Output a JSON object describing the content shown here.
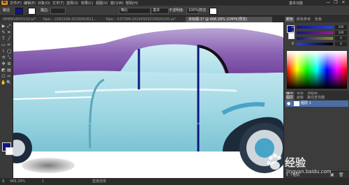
{
  "app": {
    "logo": "Ai"
  },
  "menu": [
    "文件(F)",
    "编辑(E)",
    "对象(O)",
    "文字(T)",
    "选择(S)",
    "效果(C)",
    "视图(V)",
    "窗口(W)",
    "帮助(H)"
  ],
  "workspace": "基本功能",
  "window_controls": [
    "—",
    "❐",
    "✕"
  ],
  "control_bar": {
    "selection": "路径",
    "stroke_label": "描边:",
    "stroke_value": "",
    "profile": "等比",
    "brush": "基本",
    "opacity_label": "不透明度:",
    "opacity_value": "100%",
    "style_label": "样式:",
    "fill_color": "#101680",
    "stroke_color": "#ffffff"
  },
  "doc_tabs": [
    {
      "label": "f8f8f81800f1f1f.ai*",
      "active": false
    },
    {
      "label": "Npic - 2262199-2019092811...",
      "active": false
    },
    {
      "label": "Npic - 537398-20190929215820200.ai*",
      "active": false
    },
    {
      "label": "未标题-1* @ 466.26% (CMYK/预览)",
      "active": true
    }
  ],
  "tools": [
    "▶",
    "⤢",
    "✎",
    "✒",
    "T",
    "╱",
    "▭",
    "✏",
    "⌇",
    "◯",
    "⟲",
    "⤡",
    "✥",
    "⊞",
    "◩",
    "▤",
    "⎔",
    "✂",
    "✋",
    "🔍"
  ],
  "colors": {
    "fill": "#101680",
    "stroke": "#ffffff",
    "accent": "#4b6ea8"
  },
  "right_panel": {
    "tabs_top": [
      "颜色",
      "颜色参考",
      "色板"
    ],
    "sliders": [
      {
        "label": "C",
        "value": "100",
        "color_from": "#ffffff",
        "color_to": "#00aeef"
      },
      {
        "label": "M",
        "value": "100",
        "color_from": "#ffffff",
        "color_to": "#ec008c"
      },
      {
        "label": "Y",
        "value": "0",
        "color_from": "#ffffff",
        "color_to": "#fff200"
      },
      {
        "label": "K",
        "value": "0",
        "color_from": "#ffffff",
        "color_to": "#000000"
      }
    ],
    "tabs_mid": [
      "描边",
      "渐变",
      "透明度"
    ],
    "tabs_layers": [
      "图层",
      "画板",
      "路径查找器"
    ],
    "layer": {
      "name": "图层 1"
    },
    "layers_count": "1 个图层"
  },
  "status": {
    "zoom": "466.26%",
    "tool": "直接选择",
    "page": "1"
  },
  "watermark": {
    "text": "经验",
    "sub": "jingyan.baidu.com"
  }
}
